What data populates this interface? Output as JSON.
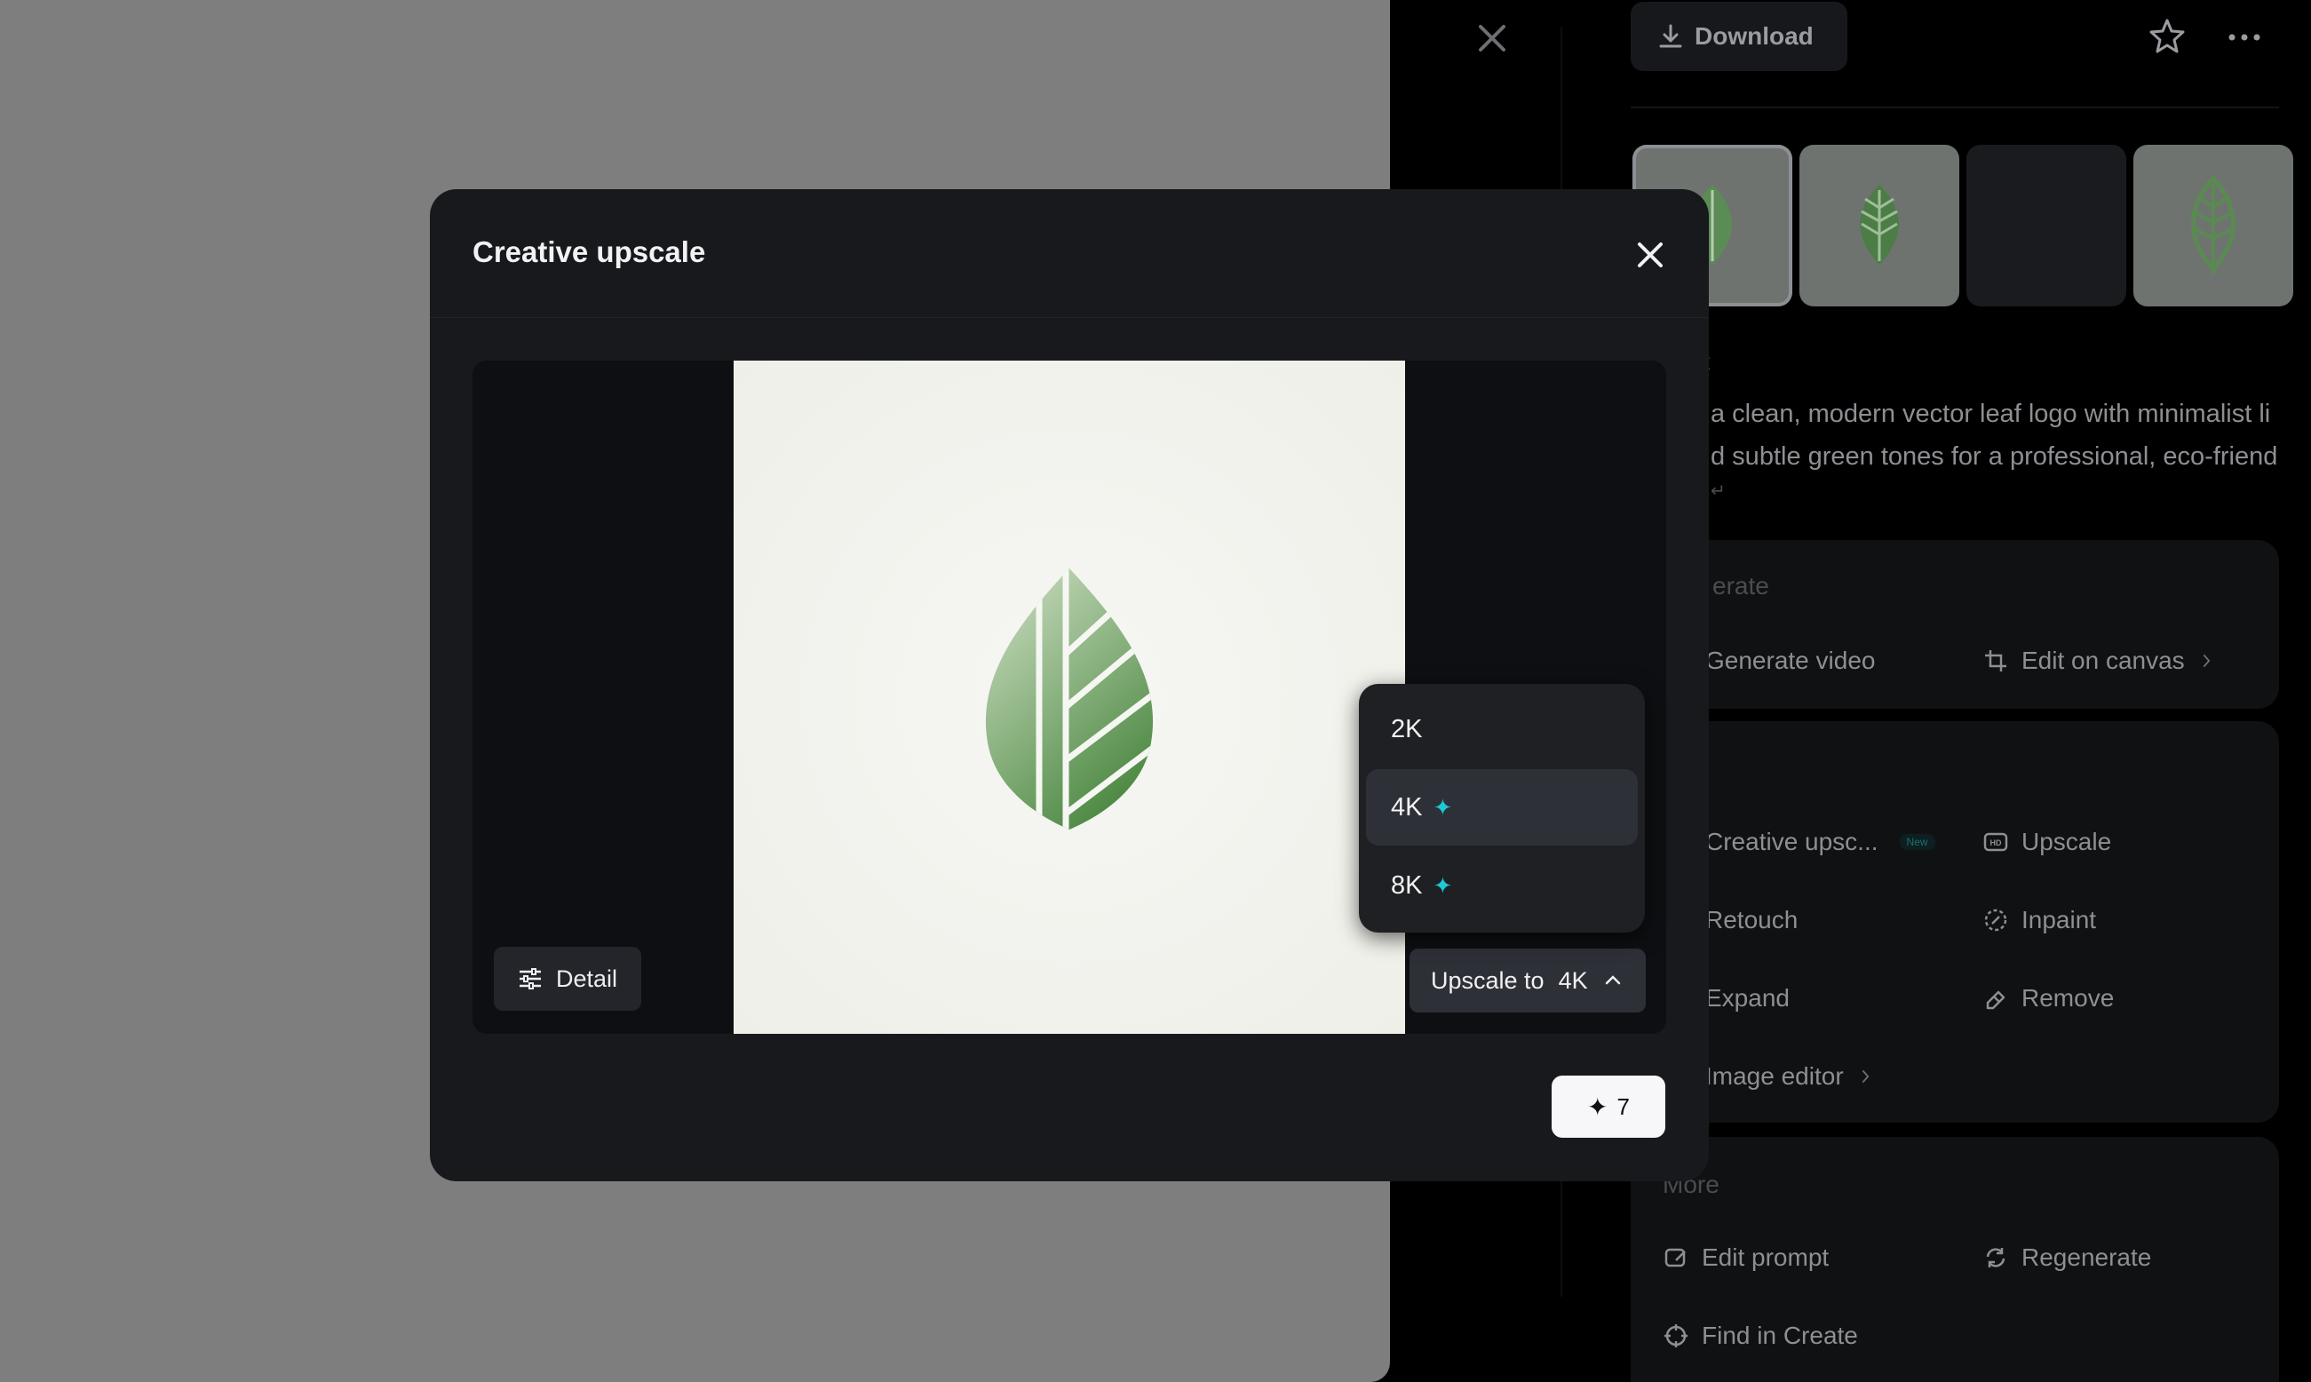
{
  "right_panel": {
    "download_label": "Download",
    "prompt_heading": "t",
    "prompt_lines": [
      "a clean, modern vector leaf logo with minimalist li",
      "d subtle green tones for a professional, eco-friend",
      "↵"
    ],
    "generate_section": {
      "title": "erate",
      "generate_video": "Generate video",
      "edit_on_canvas": "Edit on canvas"
    },
    "edit_section": {
      "creative_upscale": "Creative upsc...",
      "new_badge": "New",
      "upscale": "Upscale",
      "retouch": "Retouch",
      "inpaint": "Inpaint",
      "expand": "Expand",
      "remove": "Remove",
      "image_editor": "Image editor"
    },
    "more_section": {
      "title": "More",
      "edit_prompt": "Edit prompt",
      "regenerate": "Regenerate",
      "find_in_create": "Find in Create"
    }
  },
  "modal": {
    "title": "Creative upscale",
    "detail_label": "Detail",
    "upscale_prefix": "Upscale to",
    "upscale_value": "4K",
    "resolution_options": [
      "2K",
      "4K",
      "8K"
    ],
    "selected_resolution": "4K",
    "credits": "7"
  },
  "colors": {
    "accent_spark": "#1ec8d6",
    "leaf_dark": "#4f8a45",
    "leaf_light": "#c8dcbf"
  },
  "icons": {
    "viewer_close": "close-icon",
    "download": "download-icon",
    "favorite": "star-icon",
    "more": "more-dots-icon",
    "detail": "sliders-icon",
    "chevron": "chevron-up-icon",
    "spark": "spark-icon"
  }
}
